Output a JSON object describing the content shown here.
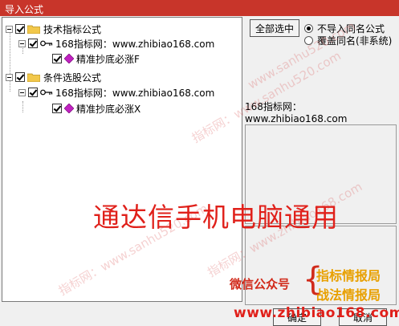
{
  "window": {
    "title": "导入公式"
  },
  "tree": {
    "nodes": [
      {
        "label": "技术指标公式"
      },
      {
        "label": "168指标网：www.zhibiao168.com"
      },
      {
        "label": "精准抄底必涨F"
      },
      {
        "label": "条件选股公式"
      },
      {
        "label": "168指标网：www.zhibiao168.com"
      },
      {
        "label": "精准抄底必涨X"
      }
    ]
  },
  "right_panel": {
    "select_all": "全部选中",
    "radio_no_import": "不导入同名公式",
    "radio_overwrite": "覆盖同名(非系统)",
    "info_text": "168指标网：\nwww.zhibiao168.com"
  },
  "buttons": {
    "ok": "确定",
    "cancel": "取消"
  },
  "overlay": {
    "headline": "通达信手机电脑通用",
    "wechat_label": "微信公众号",
    "wechat_name1": "指标情报局",
    "wechat_name2": "战法情报局",
    "url": "www.zhibiao168.com",
    "watermark1": "指标网：www.sanhu520.com",
    "watermark2": "www.sanhu520.com",
    "watermark3": "指标网：www.zhibiao168.com"
  },
  "colors": {
    "titlebar": "#c8352a",
    "accent_red": "#e0201a",
    "accent_yellow": "#e8a000"
  }
}
